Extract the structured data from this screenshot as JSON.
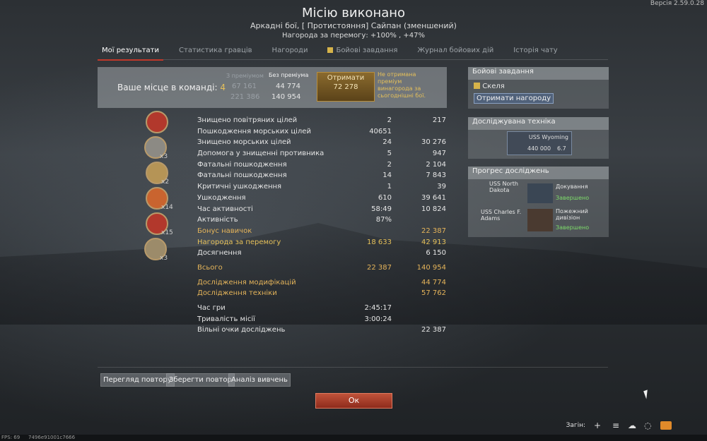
{
  "version": "Версія 2.59.0.28",
  "title": "Місію виконано",
  "subtitle": "Аркадні бої, [ Протистояння] Сайпан (зменшений)",
  "reward_line": "Нагорода за перемогу: +100% , +47%",
  "tabs": [
    "Мої результати",
    "Статистика гравців",
    "Нагороди",
    "Бойові завдання",
    "Журнал бойових дій",
    "Історія чату"
  ],
  "place": {
    "label": "Ваше місце в команді:",
    "value": "4",
    "premium_header": "З преміумом",
    "no_premium_header": "Без преміума",
    "premium_rp": "67 161",
    "premium_sl": "221 386",
    "no_premium_rp": "44 774",
    "no_premium_sl": "140 954",
    "get_label": "Отримати",
    "get_value": "72 278",
    "not_received": "Не отримана преміум винагорода за сьогоднішні бої."
  },
  "medals": [
    {
      "name": "medal-1",
      "count": ""
    },
    {
      "name": "medal-2",
      "count": "x3"
    },
    {
      "name": "medal-3",
      "count": "x2"
    },
    {
      "name": "medal-4",
      "count": "x14"
    },
    {
      "name": "medal-5",
      "count": "x15"
    },
    {
      "name": "medal-6",
      "count": "x3"
    }
  ],
  "stats": [
    {
      "label": "Знищено повітряних цілей",
      "count": "2",
      "reward": "217"
    },
    {
      "label": "Пошкодження морських цілей",
      "count": "40651",
      "reward": ""
    },
    {
      "label": "Знищено морських цілей",
      "count": "24",
      "reward": "30 276"
    },
    {
      "label": "Допомога у знищенні противника",
      "count": "5",
      "reward": "947"
    },
    {
      "label": "Фатальні пошкодження",
      "count": "2",
      "reward": "2 104"
    },
    {
      "label": "Фатальні пошкодження",
      "count": "14",
      "reward": "7 843"
    },
    {
      "label": "Критичні ушкодження",
      "count": "1",
      "reward": "39"
    },
    {
      "label": "Ушкодження",
      "count": "610",
      "reward": "39 641"
    },
    {
      "label": "Час активності",
      "count": "58:49",
      "reward": "10 824"
    },
    {
      "label": "Активність",
      "count": "87%",
      "reward": ""
    },
    {
      "label": "Бонус навичок",
      "count": "",
      "reward": "22 387"
    },
    {
      "label": "Нагорода за перемогу",
      "count": "18 633",
      "reward": "42 913"
    },
    {
      "label": "Досягнення",
      "count": "",
      "reward": "6 150"
    }
  ],
  "totals": {
    "label": "Всього",
    "rp": "22 387",
    "sl": "140 954"
  },
  "research": [
    {
      "label": "Дослідження модифікацій",
      "value": "44 774"
    },
    {
      "label": "Дослідження техніки",
      "value": "57 762"
    }
  ],
  "times": [
    {
      "label": "Час гри",
      "value": "2:45:17"
    },
    {
      "label": "Тривалість місії",
      "value": "3:00:24"
    },
    {
      "label": "Вільні очки досліджень",
      "value": "22 387"
    }
  ],
  "side_tasks": {
    "header": "Бойові завдання",
    "task": "Скеля",
    "claim": "Отримати нагороду"
  },
  "side_research": {
    "header": "Досліджувана техніка",
    "ship": "USS Wyoming",
    "cost": "440 000",
    "br": "6.7"
  },
  "side_progress": {
    "header": "Прогрес досліджень",
    "items": [
      {
        "ship": "USS North Dakota",
        "unlock": "Докування",
        "status": "Завершено"
      },
      {
        "ship": "USS Charles F. Adams",
        "unlock": "Пожежний дивізіон",
        "status": "Завершено"
      }
    ]
  },
  "buttons": {
    "replay": "Перегляд повтору",
    "save_replay": "Зберегти повтор",
    "analysis": "Аналіз вивчень",
    "ok": "Ок",
    "squad": "Загін:"
  },
  "footer": {
    "fps": "FPS: 69",
    "code": "7496e91001c7666"
  },
  "colors": {
    "gold": "#e5b45a",
    "ok_green": "#7ddc6a",
    "ok_button": "#b0402a"
  }
}
